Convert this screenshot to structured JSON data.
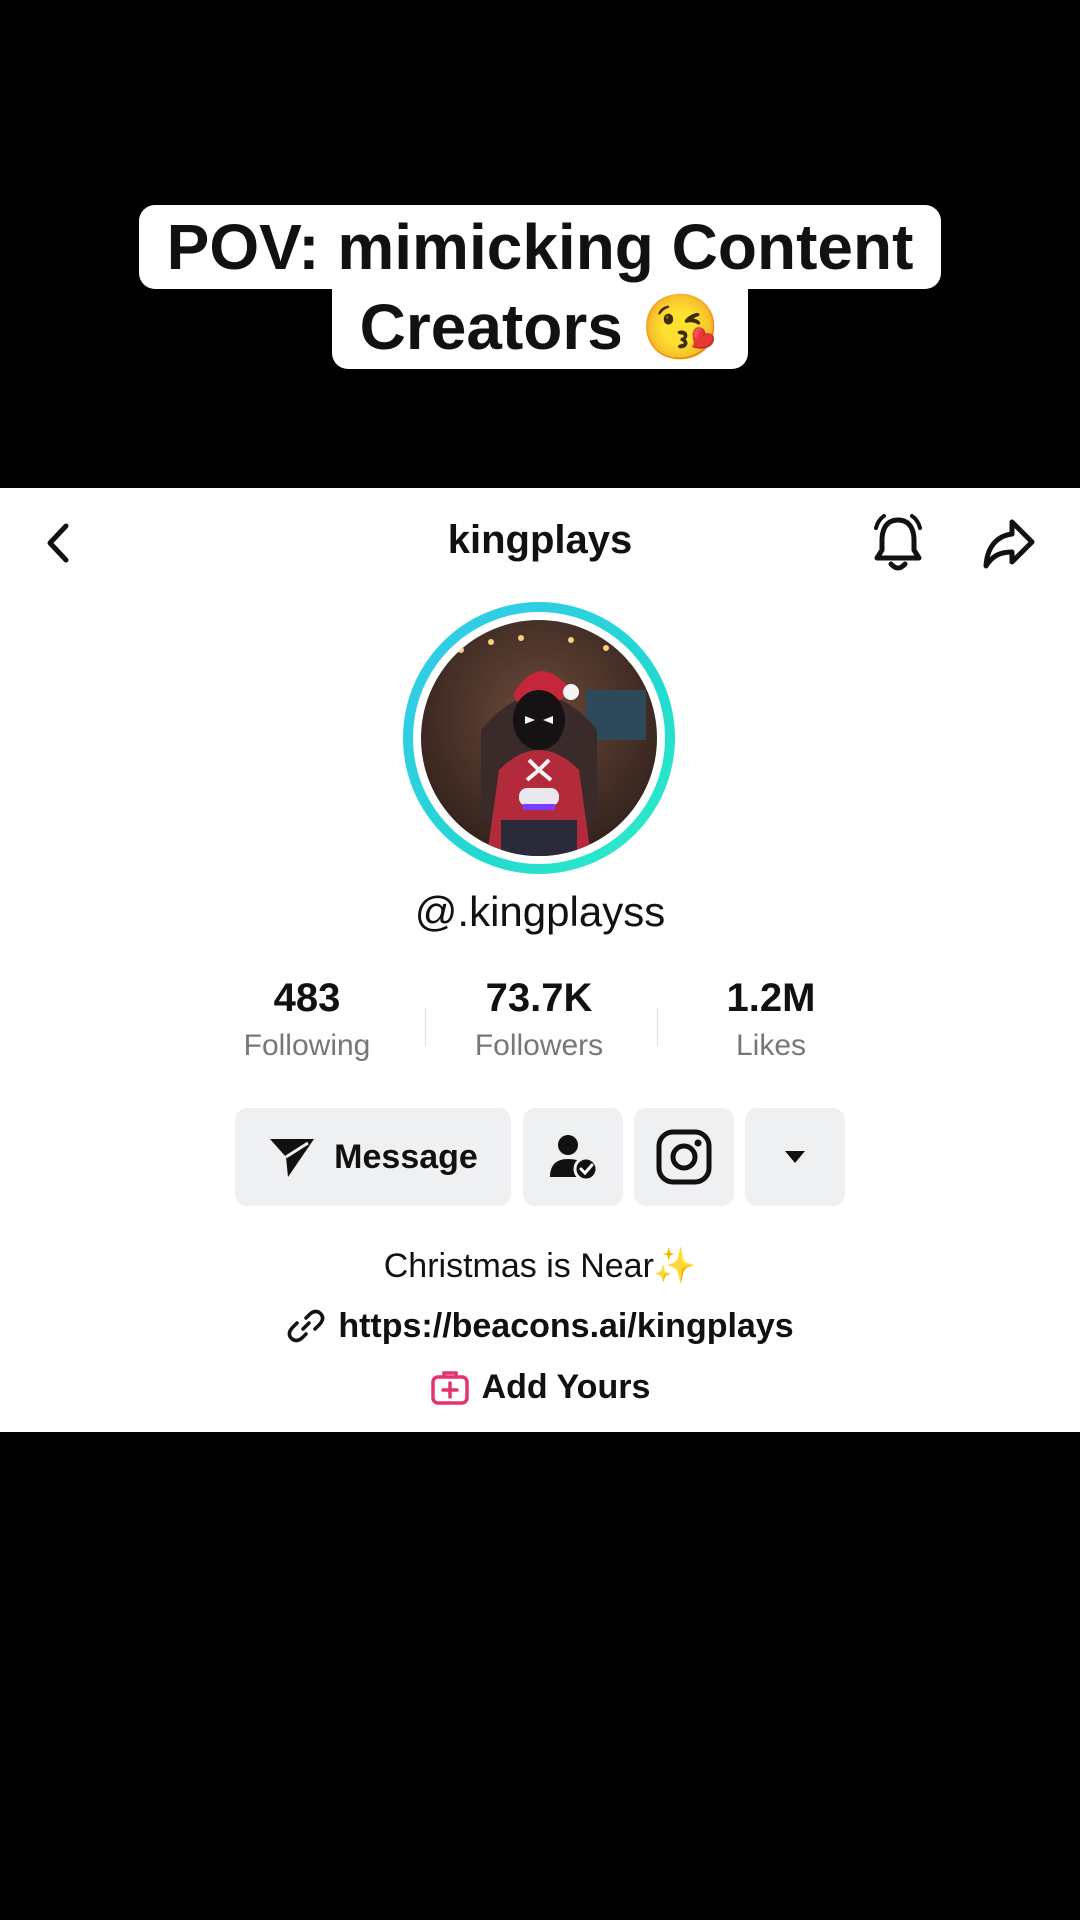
{
  "caption": {
    "line1": "POV:  mimicking Content",
    "line2": "Creators 😘"
  },
  "header": {
    "title": "kingplays",
    "back_icon": "chevron-left-icon",
    "bell_icon": "bell-icon",
    "share_icon": "share-arrow-icon"
  },
  "profile": {
    "handle": "@.kingplayss",
    "avatar_ring_color": "#2ad6d8",
    "stats": [
      {
        "value": "483",
        "label": "Following"
      },
      {
        "value": "73.7K",
        "label": "Followers"
      },
      {
        "value": "1.2M",
        "label": "Likes"
      }
    ],
    "buttons": {
      "message_label": "Message",
      "message_icon": "send-icon",
      "friend_icon": "user-check-icon",
      "instagram_icon": "instagram-icon",
      "more_icon": "caret-down-icon"
    },
    "bio": "Christmas is Near✨",
    "link": "https://beacons.ai/kingplays",
    "add_yours": "Add Yours",
    "accent_color": "#e5336b"
  }
}
